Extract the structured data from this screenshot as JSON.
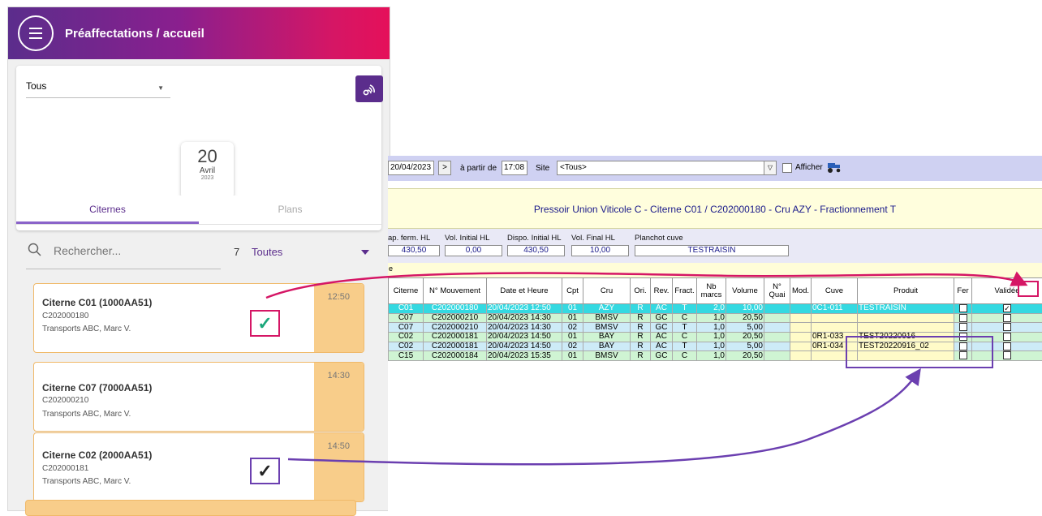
{
  "mobile": {
    "header_title": "Préaffectations / accueil",
    "filter_value": "Tous",
    "date": {
      "day": "20",
      "month": "Avril",
      "year": "2023"
    },
    "tabs": [
      {
        "label": "Citernes"
      },
      {
        "label": "Plans"
      }
    ],
    "search": {
      "placeholder": "Rechercher...",
      "count": "7",
      "filter": "Toutes"
    },
    "cards": [
      {
        "title": "Citerne C01 (1000AA51)",
        "mouvement": "C202000180",
        "transport": "Transports ABC, Marc V.",
        "time": "12:50",
        "check": "✓"
      },
      {
        "title": "Citerne C07 (7000AA51)",
        "mouvement": "C202000210",
        "transport": "Transports ABC, Marc V.",
        "time": "14:30"
      },
      {
        "title": "Citerne C02 (2000AA51)",
        "mouvement": "C202000181",
        "transport": "Transports ABC, Marc V.",
        "time": "14:50",
        "check": "✓"
      }
    ]
  },
  "desktop": {
    "toolbar": {
      "date": "20/04/2023",
      "next": ">",
      "from_label": "à partir de",
      "time": "17:08",
      "site_label": "Site",
      "site_value": "<Tous>",
      "dropdown": "▽",
      "show_label": "Afficher"
    },
    "title": "Pressoir Union Viticole C - Citerne C01 /  C202000180 - Cru AZY - Fractionnement T",
    "fields": [
      {
        "label": "ap. ferm. HL",
        "value": "430,50"
      },
      {
        "label": "Vol. Initial HL",
        "value": "0,00"
      },
      {
        "label": "Dispo. Initial HL",
        "value": "430,50"
      },
      {
        "label": "Vol. Final HL",
        "value": "10,00"
      },
      {
        "label": "Planchot cuve",
        "value": "TESTRAISIN"
      }
    ],
    "row_label": "e",
    "columns": [
      "Citerne",
      "N° Mouvement",
      "Date et Heure",
      "Cpt",
      "Cru",
      "Ori.",
      "Rev.",
      "Fract.",
      "Nb marcs",
      "Volume",
      "N° Quai",
      "Mod.",
      "Cuve",
      "Produit",
      "Fer",
      "Validée"
    ],
    "rows": [
      {
        "citerne": "C01",
        "mouvement": "C202000180",
        "date": "20/04/2023 12:50",
        "cpt": "01",
        "cru": "AZY",
        "ori": "R",
        "rev": "AC",
        "fract": "T",
        "marcs": "2,0",
        "volume": "10,00",
        "quai": "",
        "mod": "",
        "cuve": "0C1-011",
        "produit": "TESTRAISIN",
        "valid": "✓"
      },
      {
        "citerne": "C07",
        "mouvement": "C202000210",
        "date": "20/04/2023 14:30",
        "cpt": "01",
        "cru": "BMSV",
        "ori": "R",
        "rev": "GC",
        "fract": "C",
        "marcs": "1,0",
        "volume": "20,50",
        "quai": "",
        "mod": "",
        "cuve": "",
        "produit": "",
        "valid": ""
      },
      {
        "citerne": "C07",
        "mouvement": "C202000210",
        "date": "20/04/2023 14:30",
        "cpt": "02",
        "cru": "BMSV",
        "ori": "R",
        "rev": "GC",
        "fract": "T",
        "marcs": "1,0",
        "volume": "5,00",
        "quai": "",
        "mod": "",
        "cuve": "",
        "produit": "",
        "valid": ""
      },
      {
        "citerne": "C02",
        "mouvement": "C202000181",
        "date": "20/04/2023 14:50",
        "cpt": "01",
        "cru": "BAY",
        "ori": "R",
        "rev": "AC",
        "fract": "C",
        "marcs": "1,0",
        "volume": "20,50",
        "quai": "",
        "mod": "",
        "cuve": "0R1-033",
        "produit": "TEST20220916",
        "valid": ""
      },
      {
        "citerne": "C02",
        "mouvement": "C202000181",
        "date": "20/04/2023 14:50",
        "cpt": "02",
        "cru": "BAY",
        "ori": "R",
        "rev": "AC",
        "fract": "T",
        "marcs": "1,0",
        "volume": "5,00",
        "quai": "",
        "mod": "",
        "cuve": "0R1-034",
        "produit": "TEST20220916_02",
        "valid": ""
      },
      {
        "citerne": "C15",
        "mouvement": "C202000184",
        "date": "20/04/2023 15:35",
        "cpt": "01",
        "cru": "BMSV",
        "ori": "R",
        "rev": "GC",
        "fract": "C",
        "marcs": "1,0",
        "volume": "20,50",
        "quai": "",
        "mod": "",
        "cuve": "",
        "produit": "",
        "valid": ""
      }
    ]
  },
  "colors": {
    "brand_purple": "#5b2d8c",
    "brand_pink": "#d51665",
    "selected_row": "#34d9e1",
    "card_band": "#f8cd8a",
    "check_green": "#1aa77b"
  }
}
